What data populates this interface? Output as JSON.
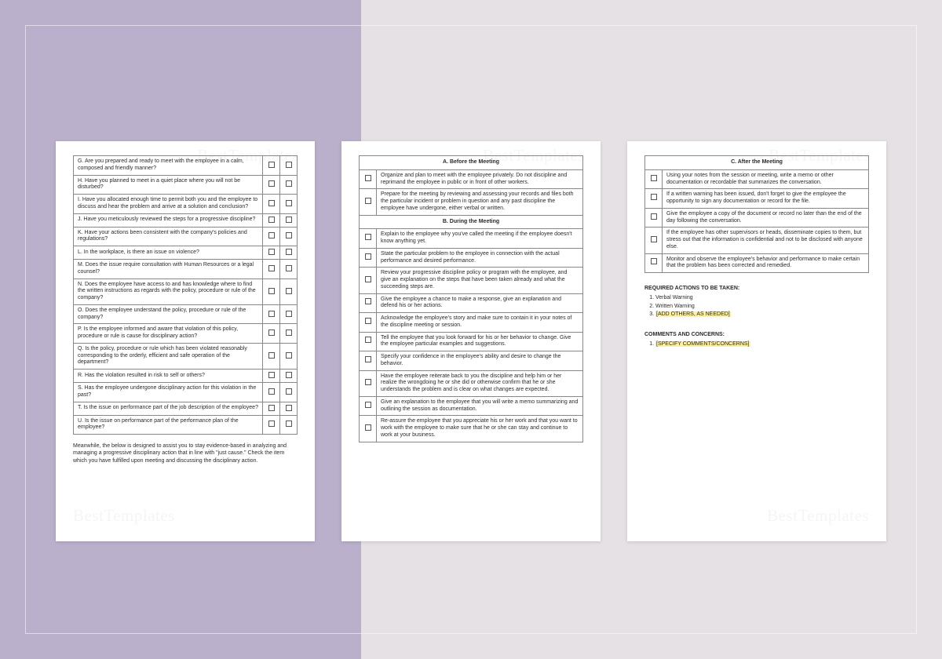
{
  "watermark": "BestTemplates",
  "page1": {
    "questions": [
      "G. Are you prepared and ready to meet with the employee in a calm, composed and friendly manner?",
      "H. Have you planned to meet in a quiet place where you will not be disturbed?",
      "I. Have you allocated enough time to permit both you and the employee to discuss and hear the problem and arrive at a solution and conclusion?",
      "J. Have you meticulously reviewed the steps for a progressive discipline?",
      "K. Have your actions been consistent with the company's policies and regulations?",
      "L. In the workplace, is there an issue on violence?",
      "M. Does the issue require consultation with Human Resources or a legal counsel?",
      "N. Does the employee have access to and has knowledge where to find the written instructions as regards with the policy, procedure or rule of the company?",
      "O. Does the employee understand the policy, procedure or rule of the company?",
      "P. Is the employee informed and aware that violation of this policy, procedure or rule is cause for disciplinary action?",
      "Q. Is the policy, procedure or rule which has been violated reasonably corresponding to the orderly, efficient and safe operation of the department?",
      "R. Has the violation resulted in risk to self or others?",
      "S. Has the employee undergone disciplinary action for this violation in the past?",
      "T. Is the issue on performance part of the job description of the employee?",
      "U. Is the issue on performance part of the performance plan of the employee?"
    ],
    "footnote": "Meanwhile, the below is designed to assist you to stay evidence-based in analyzing and managing a progressive disciplinary action that in line with \"just cause.\" Check the item which you have fulfilled upon meeting and discussing the disciplinary action."
  },
  "page2": {
    "sectionA": {
      "title": "A. Before the Meeting",
      "items": [
        "Organize and plan to meet with the employee privately. Do not discipline and reprimand the employee in public or in front of other workers.",
        "Prepare for the meeting by reviewing and assessing your records and files both the particular incident or problem in question and any past discipline the employee have undergone, either verbal or written."
      ]
    },
    "sectionB": {
      "title": "B. During the Meeting",
      "items": [
        "Explain to the employee why you've called the meeting if the employee doesn't know anything yet.",
        "State the particular problem to the employee in connection with the actual performance and desired performance.",
        "Review your progressive discipline policy or program with the employee, and give an explanation on the steps that have been taken already and what the succeeding steps are.",
        "Give the employee a chance to make a response, give an explanation and defend his or her actions.",
        "Acknowledge the employee's story and make sure to contain it in your notes of the discipline meeting or session.",
        "Tell the employee that you look forward for his or her behavior to change. Give the employee particular examples and suggestions.",
        "Specify your confidence in the employee's ability and desire to change the behavior.",
        "Have the employee reiterate back to you the discipline and help him or her realize the wrongdoing he or she did or otherwise confirm that he or she understands the problem and is clear on what changes are expected.",
        "Give an explanation to the employee that you will write a memo summarizing and outlining the session as documentation.",
        "Re-assure the employee that you appreciate his or her work and that you want to work with the employee to make sure that he or she can stay and continue to work at your business."
      ]
    }
  },
  "page3": {
    "sectionC": {
      "title": "C. After the Meeting",
      "items": [
        "Using your notes from the session or meeting, write a memo or other documentation or recordable that summarizes the conversation.",
        "If a written warning has been issued, don't forget to give the employee the opportunity to sign any documentation or record for the file.",
        "Give the employee a copy of the document or record no later than the end of the day following the conversation.",
        "If the employee has other supervisors or heads, disseminate copies to them, but stress out that the information is confidential and not to be disclosed with anyone else.",
        "Monitor and observe the employee's behavior and performance to make certain that the problem has been corrected and remedied."
      ]
    },
    "required_heading": "REQUIRED ACTIONS TO BE TAKEN:",
    "required_items": [
      "Verbal Warning",
      "Written Warning"
    ],
    "required_placeholder": "[ADD OTHERS, AS NEEDED]",
    "comments_heading": "COMMENTS AND CONCERNS:",
    "comments_placeholder": "[SPECIFY COMMENTS/CONCERNS]"
  }
}
